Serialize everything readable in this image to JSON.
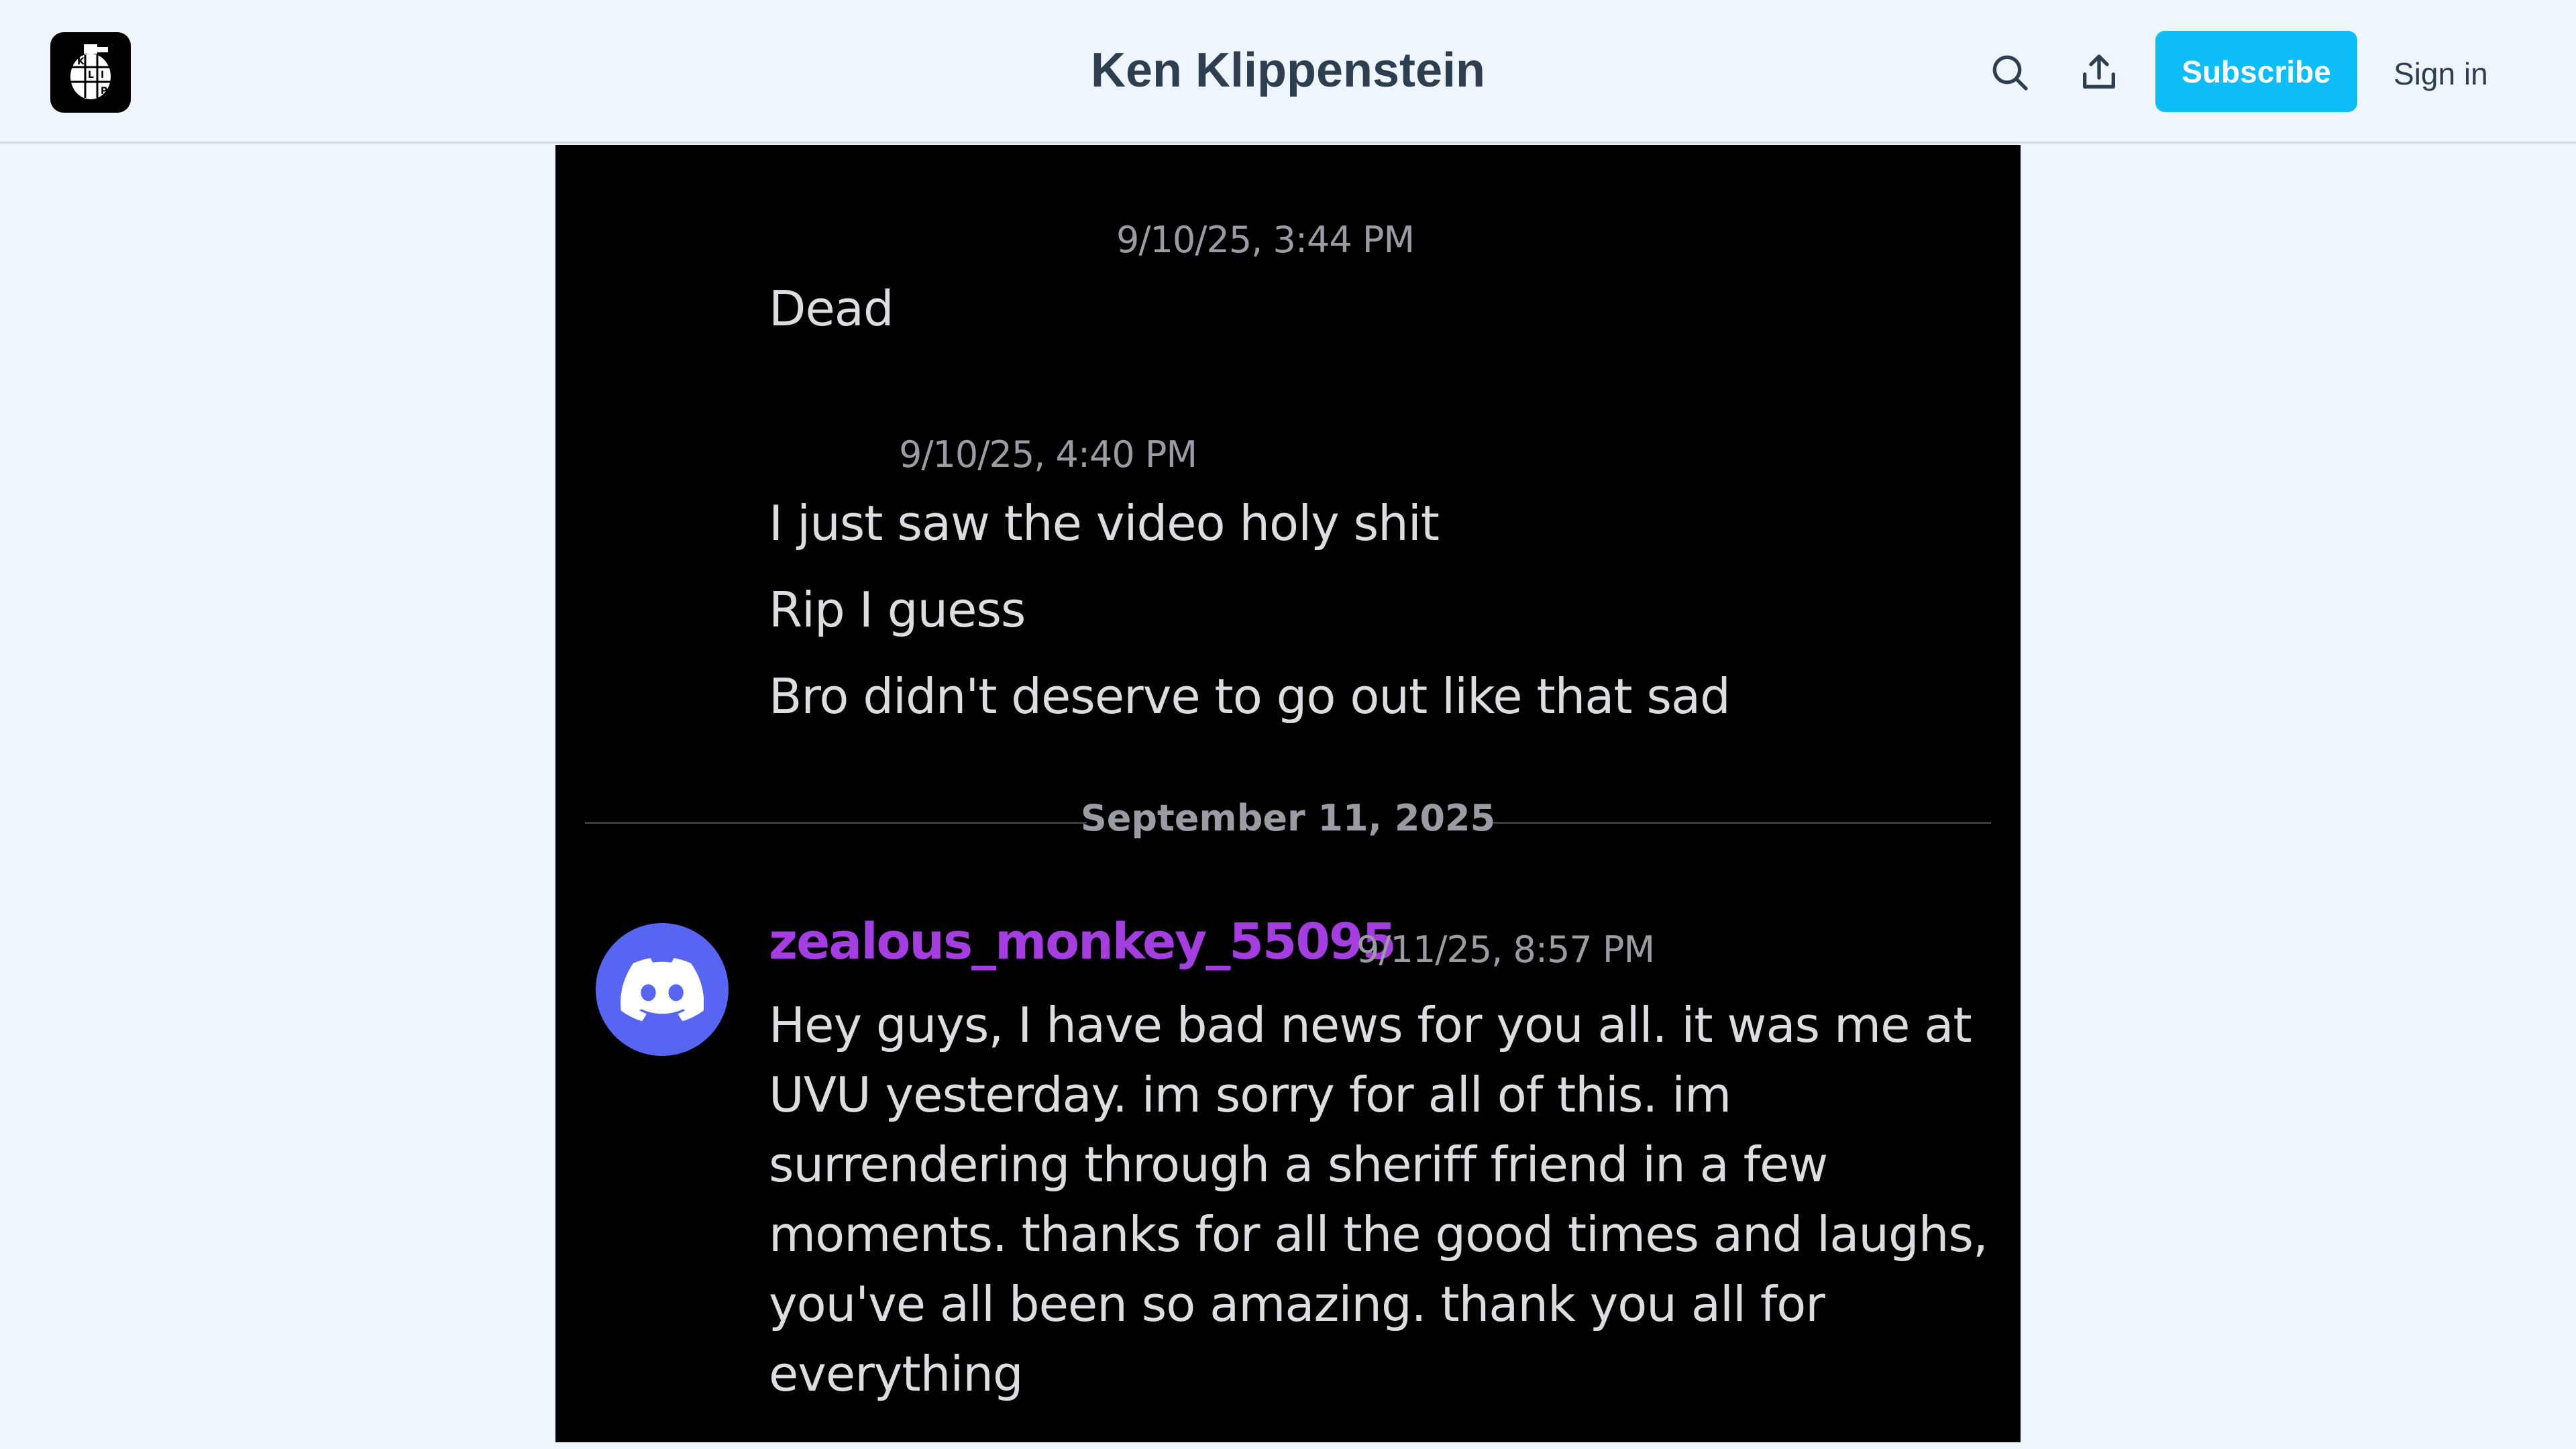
{
  "header": {
    "site_title": "Ken Klippenstein",
    "logo_letters": [
      "K",
      "L",
      "I",
      "P"
    ],
    "subscribe_label": "Subscribe",
    "signin_label": "Sign in",
    "icons": [
      "search-icon",
      "share-icon"
    ],
    "subscribe_color": "#0dbdf8"
  },
  "screenshot": {
    "messages": [
      {
        "timestamp": "9/10/25, 3:44 PM",
        "lines": [
          "Dead"
        ]
      },
      {
        "timestamp": "9/10/25, 4:40 PM",
        "lines": [
          "I just saw the video holy shit",
          "Rip I guess",
          "Bro didn't deserve to go out like that sad"
        ]
      }
    ],
    "date_divider": "September 11, 2025",
    "post": {
      "username": "zealous_monkey_55095",
      "username_color": "#a53ee0",
      "avatar_color": "#5865f2",
      "avatar_icon": "discord-icon",
      "timestamp": "9/11/25, 8:57 PM",
      "text": "Hey guys, I have bad news for you all. it was me at UVU yesterday. im sorry for all of this. im surrendering through a sheriff friend in a few moments. thanks for all the good times and laughs, you've all been so amazing. thank you all for everything"
    }
  }
}
